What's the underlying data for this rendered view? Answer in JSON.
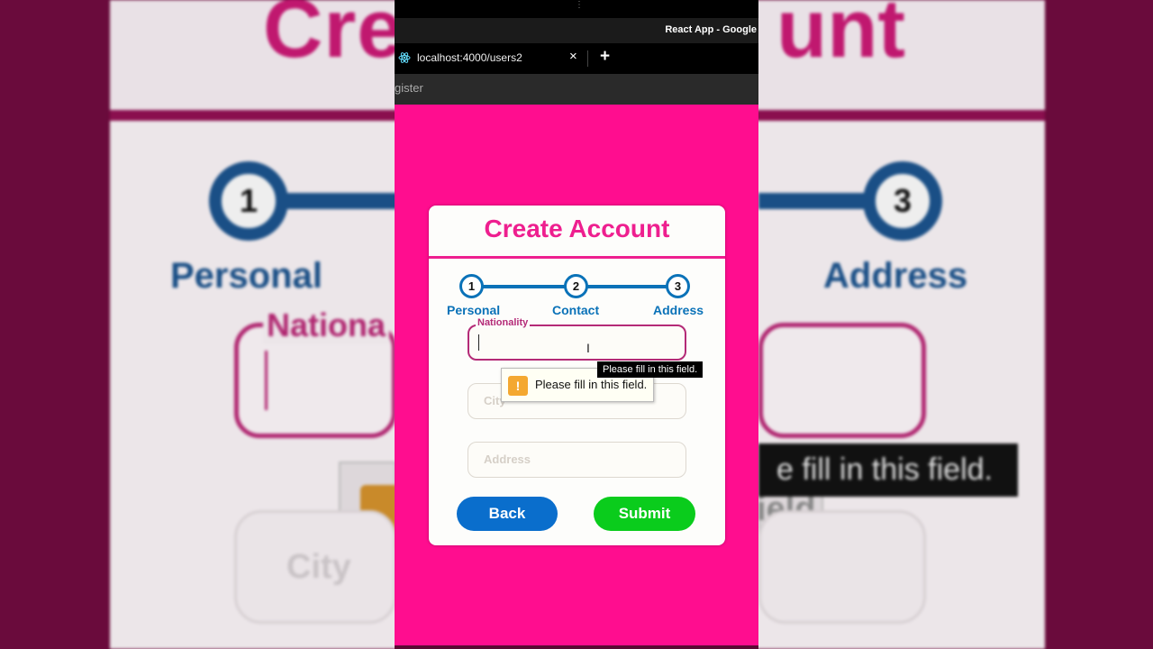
{
  "browser": {
    "window_title": "React App - Google",
    "tab_title": "localhost:4000/users2",
    "tab_close": "×",
    "new_tab": "+",
    "address_text": "gister"
  },
  "form": {
    "title": "Create Account",
    "steps": [
      {
        "number": "1",
        "label": "Personal"
      },
      {
        "number": "2",
        "label": "Contact"
      },
      {
        "number": "3",
        "label": "Address"
      }
    ],
    "nationality_label": "Nationality",
    "nationality_value": "",
    "city_placeholder": "City",
    "address_placeholder": "Address",
    "back_label": "Back",
    "submit_label": "Submit"
  },
  "validation": {
    "popup_text": "Please fill in this field.",
    "tooltip_text": "Please fill in this field.",
    "warn_glyph": "!"
  },
  "background": {
    "title_left": "Cre",
    "title_right": "unt",
    "step1": "1",
    "step3": "3",
    "label_left": "Personal",
    "label_right": "Address",
    "field_label": "Nationa",
    "tooltip": "e fill in this field.",
    "ghost_city": "City",
    "ghost_popup": "ield."
  },
  "colors": {
    "accent_pink": "#ee1f8f",
    "page_pink": "#ff0d8f",
    "step_blue": "#0a72b8",
    "back_blue": "#0a6ecc",
    "submit_green": "#0acc1c"
  }
}
